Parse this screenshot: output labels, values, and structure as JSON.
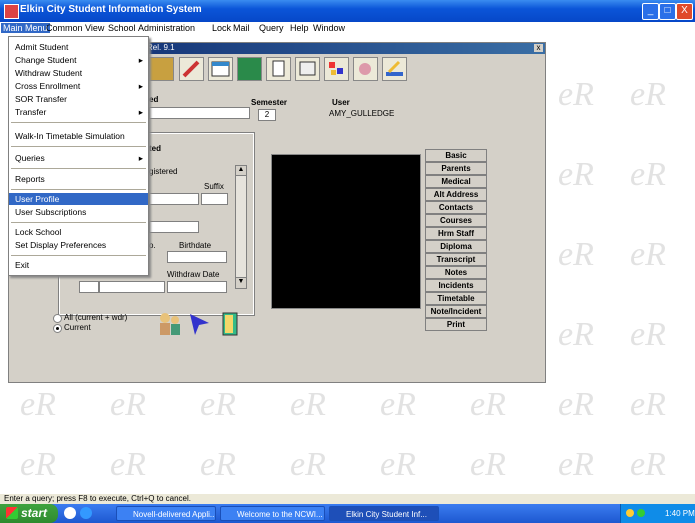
{
  "app": {
    "title": "Elkin City Student Information System"
  },
  "window_controls": {
    "minimize": "_",
    "maximize": "□",
    "close": "X"
  },
  "menubar": {
    "main_menu": "Main Menu",
    "common_view": "Common View",
    "school": "School",
    "administration": "Administration",
    "lock": "Lock",
    "mail": "Mail",
    "query": "Query",
    "help": "Help",
    "window": "Window"
  },
  "child_window": {
    "title": "Rel. 9.1",
    "close": "x",
    "fields": {
      "ed_label": "ed",
      "semester_label": "Semester",
      "semester_value": "2",
      "user_label": "User",
      "user_value": "AMY_GULLEDGE",
      "ted_label": "ted",
      "registered_label": "gistered",
      "suffix_label": "Suffix",
      "o_label": "o.",
      "birthdate_label": "Birthdate",
      "withdraw_date_label": "Withdraw Date"
    },
    "radio_all": "All (current + wdr)",
    "radio_current": "Current",
    "side_buttons": [
      "Basic",
      "Parents",
      "Medical",
      "Alt Address",
      "Contacts",
      "Courses",
      "Hrm Staff",
      "Diploma",
      "Transcript",
      "Notes",
      "Incidents",
      "Timetable",
      "Note/Incident",
      "Print"
    ]
  },
  "dropdown": {
    "items": [
      {
        "label": "Admit Student",
        "has_submenu": false
      },
      {
        "label": "Change Student",
        "has_submenu": true
      },
      {
        "label": "Withdraw Student",
        "has_submenu": false
      },
      {
        "label": "Cross Enrollment",
        "has_submenu": true
      },
      {
        "label": "SOR Transfer",
        "has_submenu": false
      },
      {
        "label": "Transfer",
        "has_submenu": true
      },
      {
        "label": "Walk-In Timetable Simulation",
        "has_submenu": false
      },
      {
        "label": "Queries",
        "has_submenu": true
      },
      {
        "label": "Reports",
        "has_submenu": false
      },
      {
        "label": "User Profile",
        "has_submenu": false,
        "highlighted": true
      },
      {
        "label": "User Subscriptions",
        "has_submenu": false
      },
      {
        "label": "Lock School",
        "has_submenu": false
      },
      {
        "label": "Set Display Preferences",
        "has_submenu": false
      },
      {
        "label": "Exit",
        "has_submenu": false
      }
    ]
  },
  "status_bar": {
    "text": "Enter a query; press F8 to execute, Ctrl+Q to cancel."
  },
  "taskbar": {
    "start": "start",
    "tasks": [
      {
        "label": "Novell-delivered Appli..."
      },
      {
        "label": "Welcome to the NCWI..."
      },
      {
        "label": "Elkin City Student Inf..."
      }
    ],
    "clock": "1:40 PM"
  },
  "colors": {
    "title_bar": "#0b55d8",
    "highlight": "#3168c6",
    "taskbar": "#245edc",
    "start_button": "#3a9a3a"
  }
}
